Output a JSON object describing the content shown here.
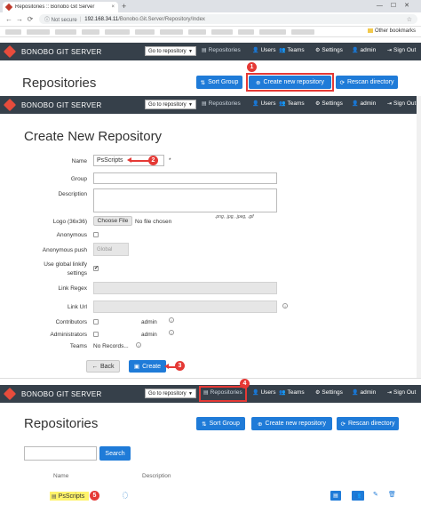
{
  "browser": {
    "tab_title": "Repositories :: Bonobo Git Server",
    "tab_close": "×",
    "new_tab": "+",
    "window_controls": "—☐✕",
    "nav_back": "←",
    "nav_forward": "→",
    "nav_reload": "⟳",
    "not_secure": "ⓘ Not secure",
    "url_host": "192.168.34.11",
    "url_path": "/Bonobo.Git.Server/Repository/Index",
    "other_bookmarks": "Other bookmarks",
    "star": "☆"
  },
  "navbar": {
    "brand": "BONOBO GIT SERVER",
    "go_to_repository": "Go to repository",
    "caret": "▼",
    "items": {
      "repositories": "Repositories",
      "users": "Users",
      "teams": "Teams",
      "settings": "Settings",
      "admin": "admin",
      "sign_out": "Sign Out"
    }
  },
  "repos_top": {
    "title": "Repositories",
    "sort_group": "Sort Group",
    "create_new": "Create new repository",
    "rescan": "Rescan directory"
  },
  "create_form": {
    "title": "Create New Repository",
    "labels": {
      "name": "Name",
      "group": "Group",
      "description": "Description",
      "logo": "Logo (36x36)",
      "anonymous": "Anonymous",
      "anonymous_push": "Anonymous push",
      "global_linkify_1": "Use global linkify",
      "global_linkify_2": "settings",
      "link_regex": "Link Regex",
      "link_url": "Link Url",
      "contributors": "Contributors",
      "administrators": "Administrators",
      "teams": "Teams"
    },
    "name_value": "PsScripts",
    "required_mark": "*",
    "choose_file": "Choose File",
    "no_file": "No file chosen",
    "file_types": ".png, .jpg, .jpeg, .gif",
    "anonymous_push_value": "Global",
    "contributors_value": "admin",
    "administrators_value": "admin",
    "teams_value": "No Records...",
    "back": "Back",
    "create": "Create",
    "info_mark": "i"
  },
  "repos_bottom": {
    "title": "Repositories",
    "sort_group": "Sort Group",
    "create_new": "Create new repository",
    "rescan": "Rescan directory",
    "search_button": "Search",
    "search_value": "",
    "col_name": "Name",
    "col_description": "Description",
    "repo_name": "PsScripts"
  },
  "callouts": [
    "1",
    "2",
    "3",
    "4",
    "5"
  ],
  "icons": {
    "user": "👤",
    "team": "👥",
    "gear": "⚙",
    "repo": "▤",
    "sort": "⇅",
    "plus": "⊕",
    "rescan": "⟳",
    "signout": "⇥",
    "back": "←",
    "save": "▣",
    "edit": "✎",
    "delete": "🗑"
  },
  "colors": {
    "navbar": "#36404a",
    "primary": "#1f7bd8",
    "callout": "#e53935",
    "highlight": "#fff36b"
  }
}
